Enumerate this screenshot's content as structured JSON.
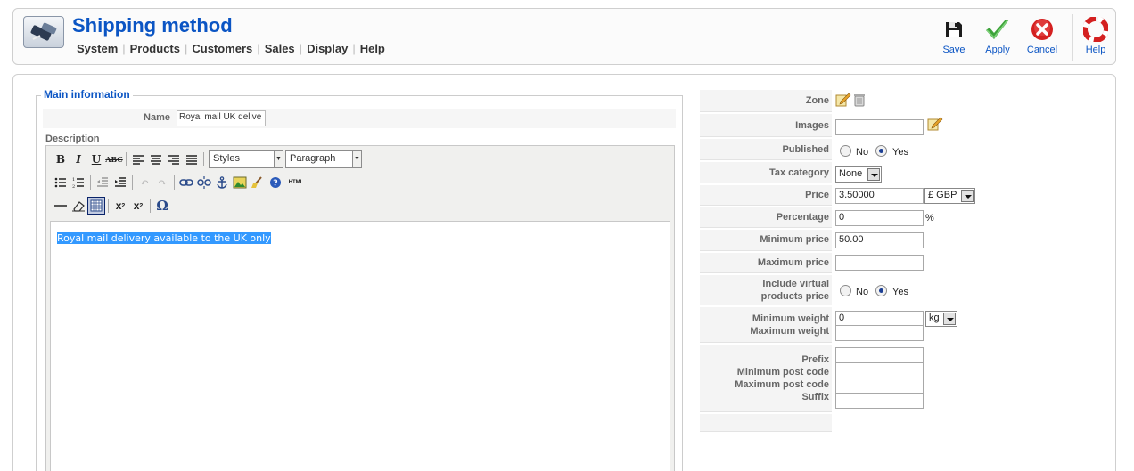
{
  "header": {
    "title": "Shipping method",
    "menu": [
      "System",
      "Products",
      "Customers",
      "Sales",
      "Display",
      "Help"
    ],
    "toolbar": {
      "save": "Save",
      "apply": "Apply",
      "cancel": "Cancel",
      "help": "Help"
    }
  },
  "main_info": {
    "legend": "Main information",
    "name_label": "Name",
    "name_value": "Royal mail UK delive",
    "description_label": "Description",
    "editor": {
      "styles_select": "Styles",
      "format_select": "Paragraph",
      "html_button": "HTML",
      "content": "Royal mail delivery available to the UK only"
    }
  },
  "form": {
    "zone_label": "Zone",
    "images_label": "Images",
    "images_value": "",
    "published_label": "Published",
    "published_no": "No",
    "published_yes": "Yes",
    "published_selected": "Yes",
    "tax_label": "Tax category",
    "tax_value": "None",
    "price_label": "Price",
    "price_value": "3.50000",
    "currency_value": "£ GBP",
    "percentage_label": "Percentage",
    "percentage_value": "0",
    "percent_sign": "%",
    "min_price_label": "Minimum price",
    "min_price_value": "50.00",
    "max_price_label": "Maximum price",
    "max_price_value": "",
    "virtual_label_1": "Include virtual",
    "virtual_label_2": "products price",
    "virtual_no": "No",
    "virtual_yes": "Yes",
    "virtual_selected": "Yes",
    "min_weight_label": "Minimum weight",
    "min_weight_value": "0",
    "weight_unit": "kg",
    "max_weight_label": "Maximum weight",
    "max_weight_value": "",
    "prefix_label": "Prefix",
    "min_post_label": "Minimum post code",
    "max_post_label": "Maximum post code",
    "suffix_label": "Suffix"
  },
  "colors": {
    "accent": "#0b55c4",
    "selection": "#3399ff"
  }
}
